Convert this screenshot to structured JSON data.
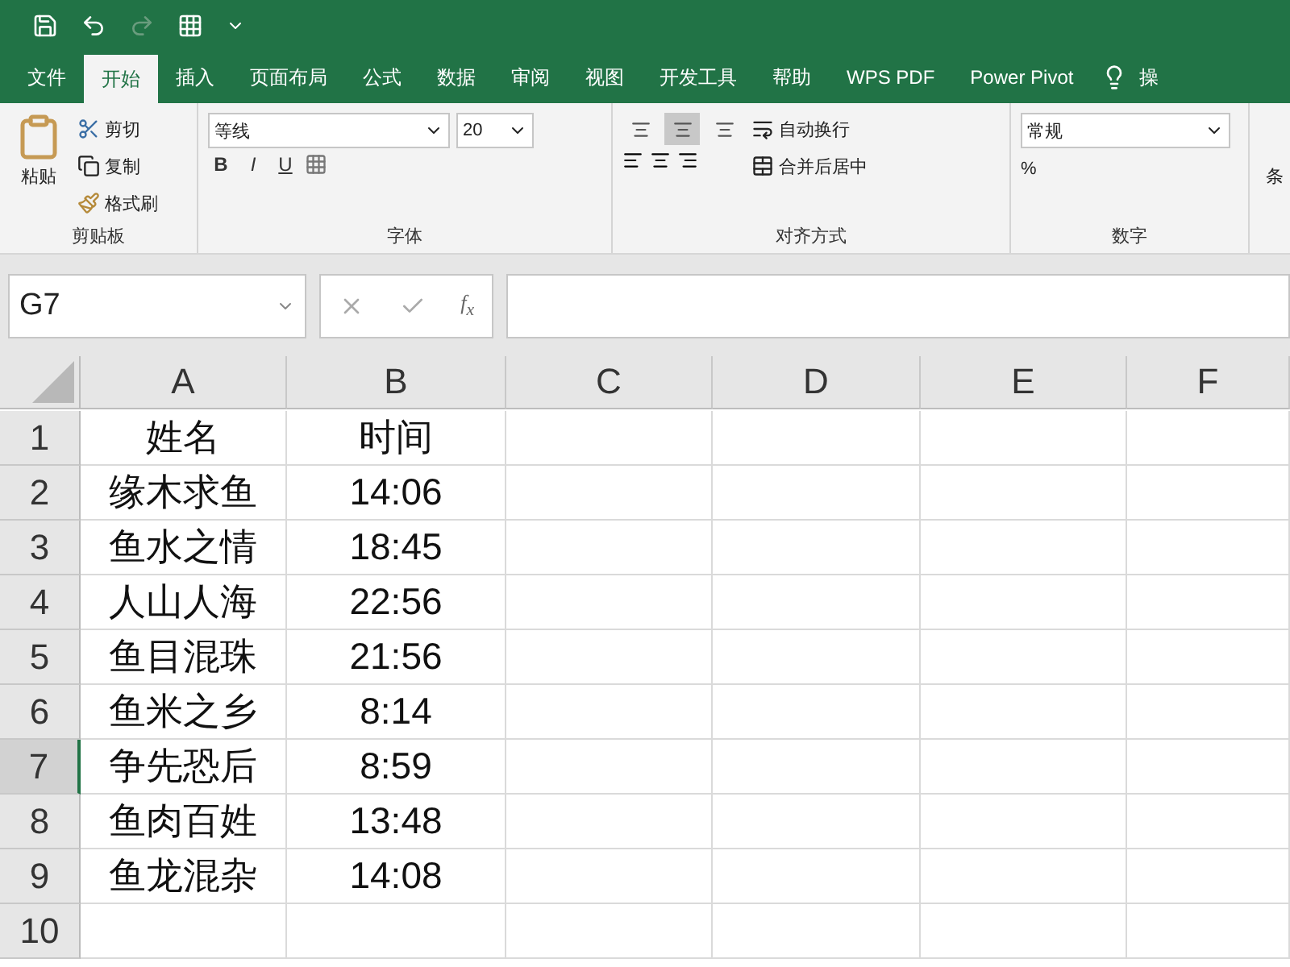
{
  "tabs": [
    {
      "label": "文件",
      "selected": false
    },
    {
      "label": "开始",
      "selected": true
    },
    {
      "label": "插入",
      "selected": false
    },
    {
      "label": "页面布局",
      "selected": false
    },
    {
      "label": "公式",
      "selected": false
    },
    {
      "label": "数据",
      "selected": false
    },
    {
      "label": "审阅",
      "selected": false
    },
    {
      "label": "视图",
      "selected": false
    },
    {
      "label": "开发工具",
      "selected": false
    },
    {
      "label": "帮助",
      "selected": false
    },
    {
      "label": "WPS PDF",
      "selected": false
    },
    {
      "label": "Power Pivot",
      "selected": false
    }
  ],
  "tell_me": "操",
  "ribbon": {
    "clipboard": {
      "paste": "粘贴",
      "cut": "剪切",
      "copy": "复制",
      "format_painter": "格式刷",
      "label": "剪贴板"
    },
    "font": {
      "font_name": "等线",
      "font_size": "20",
      "bold": "B",
      "italic": "I",
      "underline": "U",
      "label": "字体"
    },
    "alignment": {
      "vertical": [
        {
          "selected": false
        },
        {
          "selected": true
        },
        {
          "selected": false
        }
      ],
      "wrap": "自动换行",
      "merge": "合并后居中",
      "label": "对齐方式"
    },
    "number": {
      "format": "常规",
      "percent": "%",
      "label": "数字"
    },
    "next_group": "条"
  },
  "formula_bar": {
    "name_box": "G7",
    "fx": "f$_{x}$"
  },
  "sheet": {
    "columns": [
      "A",
      "B",
      "C",
      "D",
      "E",
      "F"
    ],
    "rows": [
      {
        "header": "1",
        "selected": false,
        "cells": [
          "姓名",
          "时间"
        ]
      },
      {
        "header": "2",
        "selected": false,
        "cells": [
          "缘木求鱼",
          "14:06"
        ]
      },
      {
        "header": "3",
        "selected": false,
        "cells": [
          "鱼水之情",
          "18:45"
        ]
      },
      {
        "header": "4",
        "selected": false,
        "cells": [
          "人山人海",
          "22:56"
        ]
      },
      {
        "header": "5",
        "selected": false,
        "cells": [
          "鱼目混珠",
          "21:56"
        ]
      },
      {
        "header": "6",
        "selected": false,
        "cells": [
          "鱼米之乡",
          "8:14"
        ]
      },
      {
        "header": "7",
        "selected": true,
        "cells": [
          "争先恐后",
          "8:59"
        ]
      },
      {
        "header": "8",
        "selected": false,
        "cells": [
          "鱼肉百姓",
          "13:48"
        ]
      },
      {
        "header": "9",
        "selected": false,
        "cells": [
          "鱼龙混杂",
          "14:08"
        ]
      },
      {
        "header": "10",
        "selected": false
      }
    ]
  }
}
